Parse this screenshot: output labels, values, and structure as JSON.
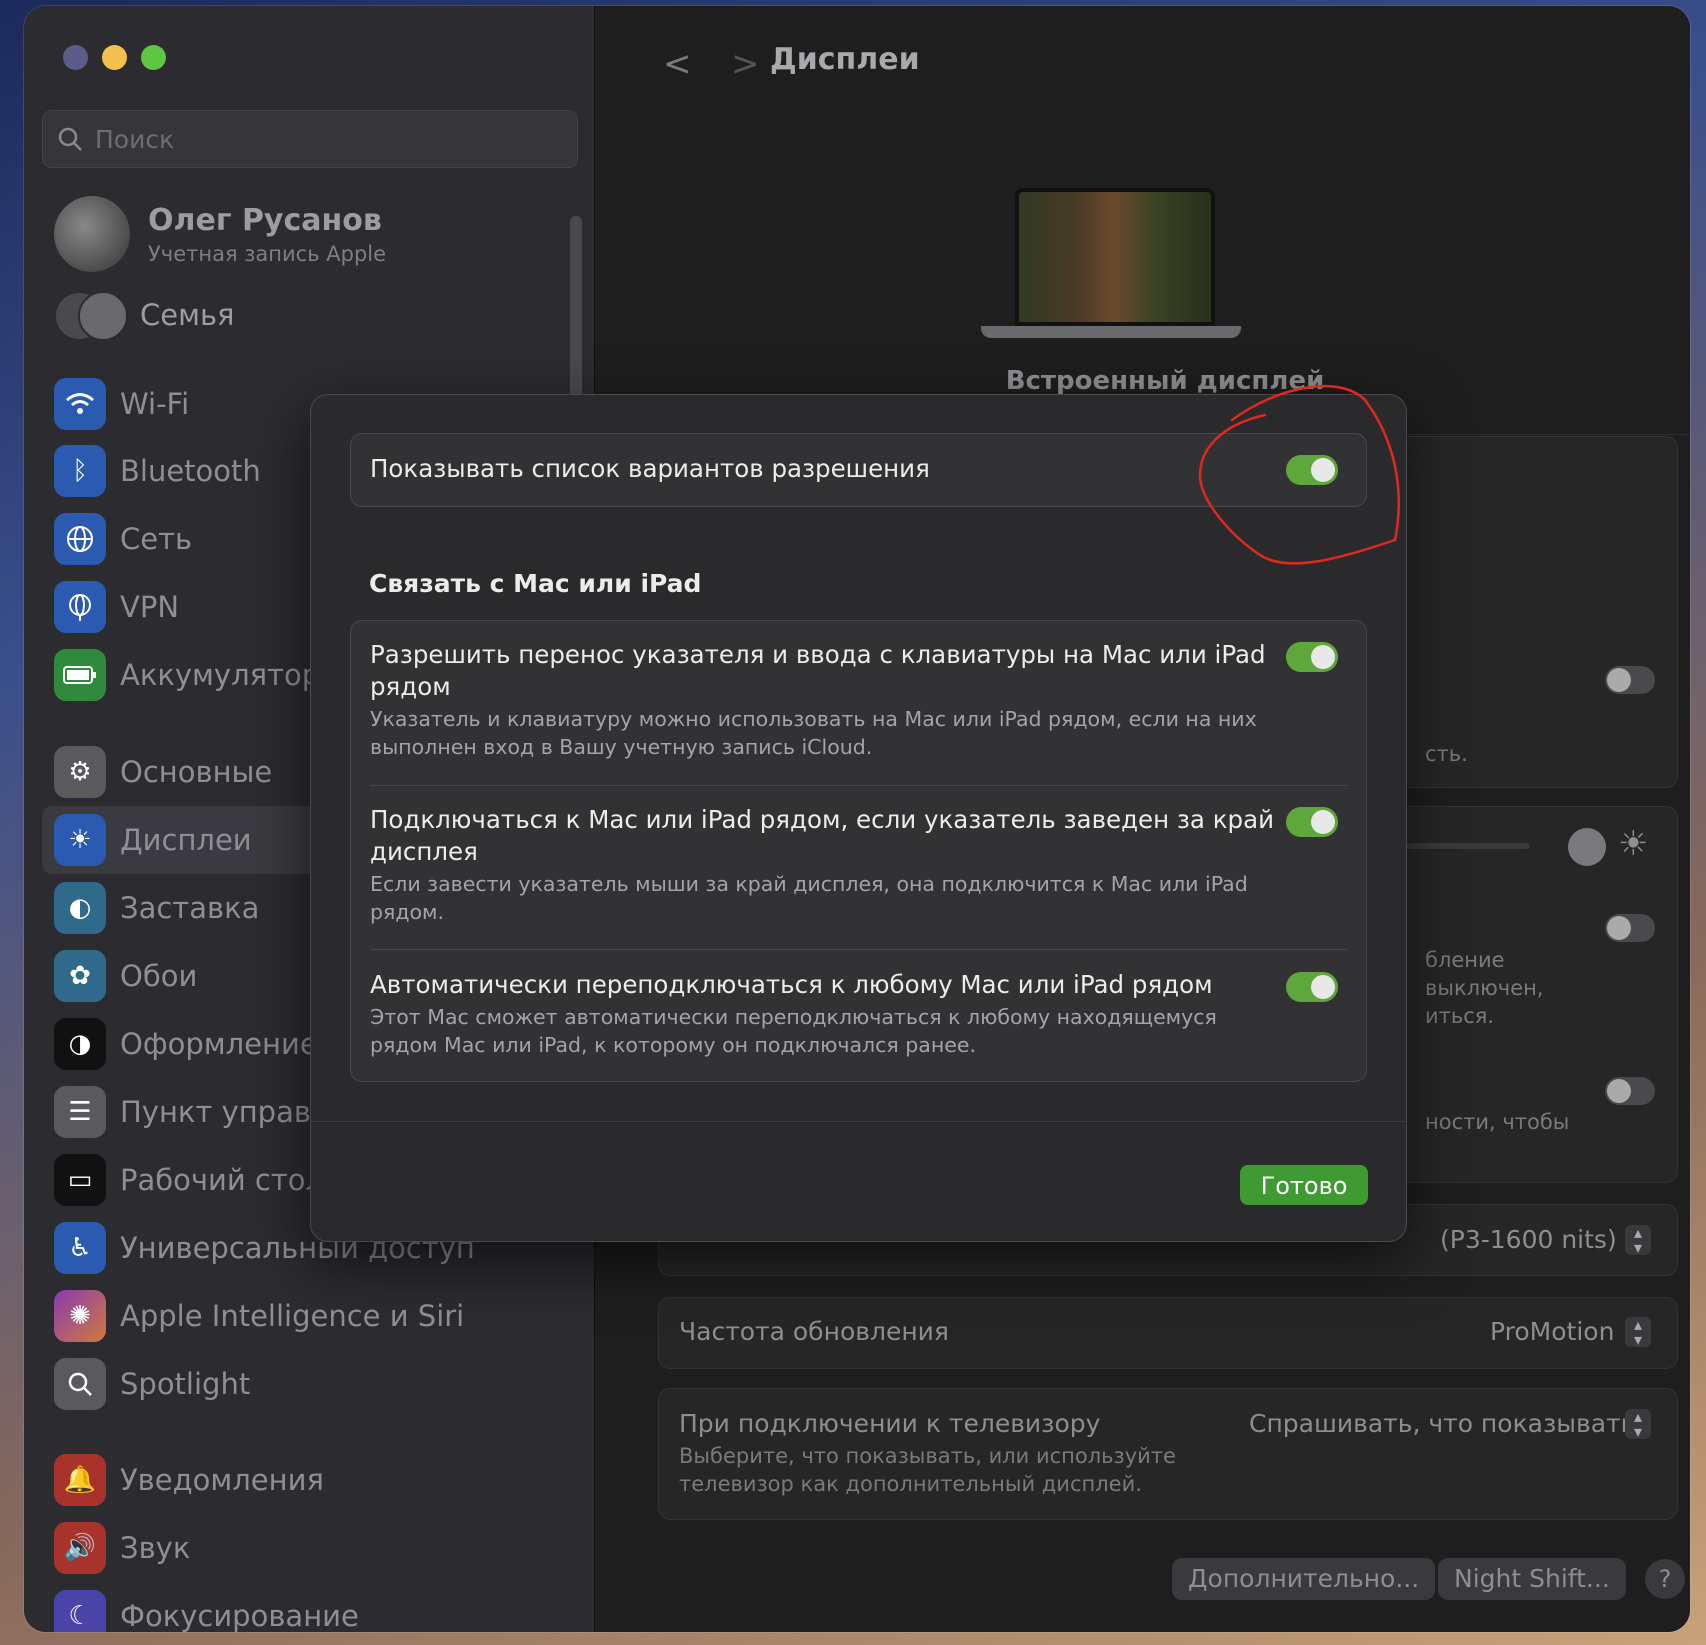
{
  "sidebar": {
    "search_placeholder": "Поиск",
    "account": {
      "name": "Олег Русанов",
      "subtitle": "Учетная запись Apple"
    },
    "family_label": "Семья",
    "items": [
      {
        "label": "Wi-Fi",
        "icon": "wifi-icon",
        "color": "#3478f6"
      },
      {
        "label": "Bluetooth",
        "icon": "bluetooth-icon",
        "color": "#3478f6"
      },
      {
        "label": "Сеть",
        "icon": "globe-icon",
        "color": "#3478f6"
      },
      {
        "label": "VPN",
        "icon": "globe-vpn-icon",
        "color": "#3478f6"
      },
      {
        "label": "Аккумулятор",
        "icon": "battery-icon",
        "color": "#34c759"
      },
      {
        "label": "Основные",
        "icon": "gear-icon",
        "color": "#8e8e93"
      },
      {
        "label": "Дисплеи",
        "icon": "sun-icon",
        "color": "#3478f6"
      },
      {
        "label": "Заставка",
        "icon": "screensaver-icon",
        "color": "#5ac8fa"
      },
      {
        "label": "Обои",
        "icon": "flower-icon",
        "color": "#5ac8fa"
      },
      {
        "label": "Оформление",
        "icon": "appearance-icon",
        "color": "#1c1c1e"
      },
      {
        "label": "Пункт управл",
        "icon": "control-center-icon",
        "color": "#8e8e93"
      },
      {
        "label": "Рабочий стол",
        "icon": "desktop-icon",
        "color": "#1c1c1e"
      },
      {
        "label": "Универсальный доступ",
        "icon": "accessibility-icon",
        "color": "#3478f6"
      },
      {
        "label": "Apple Intelligence и Siri",
        "icon": "siri-icon",
        "color": "#af52de"
      },
      {
        "label": "Spotlight",
        "icon": "magnifier-icon",
        "color": "#8e8e93"
      },
      {
        "label": "Уведомления",
        "icon": "bell-icon",
        "color": "#ff3b30"
      },
      {
        "label": "Звук",
        "icon": "speaker-icon",
        "color": "#ff3b30"
      },
      {
        "label": "Фокусирование",
        "icon": "moon-icon",
        "color": "#5856d6"
      }
    ]
  },
  "main": {
    "title": "Дисплеи",
    "display_label": "Встроенный дисплей",
    "bg_fragments": {
      "a": "сть.",
      "b": "бление",
      "c": "выключен,",
      "d": "иться.",
      "e": "ности, чтобы"
    },
    "preset_value": "(P3-1600 nits)",
    "refresh": {
      "label": "Частота обновления",
      "value": "ProMotion"
    },
    "tv": {
      "label": "При подключении к телевизору",
      "value": "Спрашивать, что показывать",
      "desc_line1": "Выберите, что показывать, или используйте",
      "desc_line2": "телевизор как дополнительный дисплей."
    },
    "buttons": {
      "advanced": "Дополнительно...",
      "night_shift": "Night Shift...",
      "help": "?"
    }
  },
  "modal": {
    "resolution_row": {
      "title": "Показывать список вариантов разрешения",
      "on": true
    },
    "section_title": "Связать с Mac или iPad",
    "rows": [
      {
        "title_line1": "Разрешить перенос указателя и ввода с клавиатуры на Mac или iPad",
        "title_line2": "рядом",
        "desc_line1": "Указатель и клавиатуру можно использовать на Mac или iPad рядом, если на них",
        "desc_line2": "выполнен вход в Вашу учетную запись iCloud.",
        "on": true
      },
      {
        "title_line1": "Подключаться к Mac или iPad рядом, если указатель заведен за край",
        "title_line2": "дисплея",
        "desc_line1": "Если завести указатель мыши за край дисплея, она подключится к Mac или iPad",
        "desc_line2": "рядом.",
        "on": true
      },
      {
        "title_line1": "Автоматически переподключаться к любому Mac или iPad рядом",
        "desc_line1": "Этот Mac сможет автоматически переподключаться к любому находящемуся",
        "desc_line2": "рядом Mac или iPad, к которому он подключался ранее.",
        "on": true
      }
    ],
    "done_label": "Готово"
  },
  "colors": {
    "accent_green": "#3f9a33",
    "toggle_on": "#5fa73c",
    "annotation_red": "#e0281e"
  }
}
